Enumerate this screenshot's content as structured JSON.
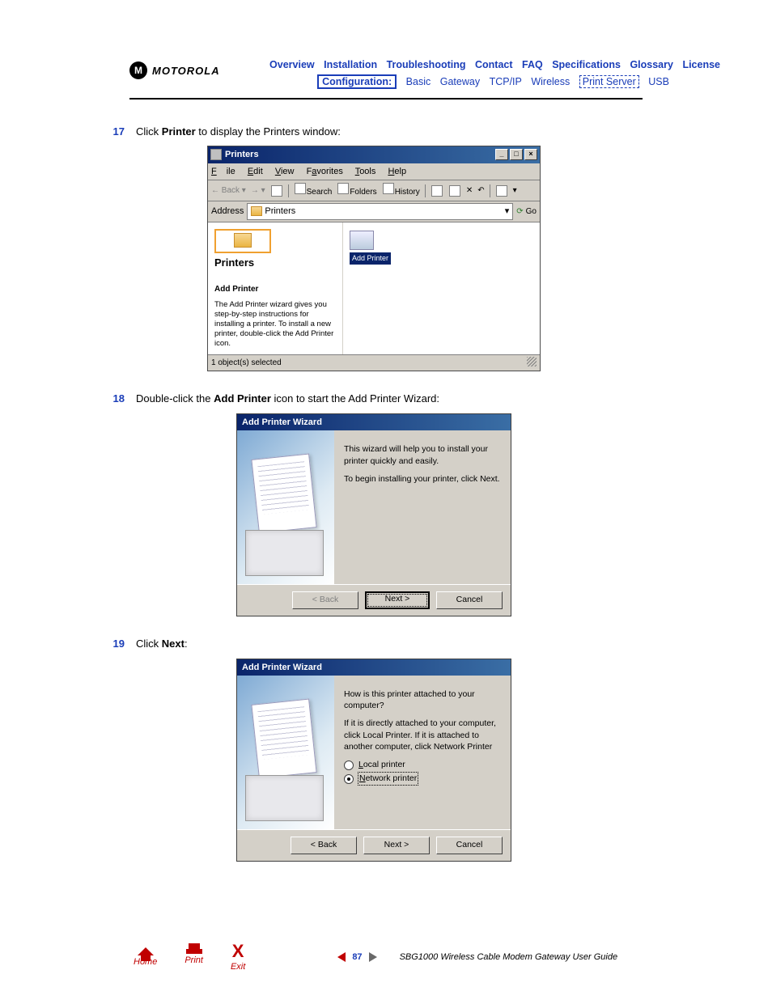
{
  "logo_text": "MOTOROLA",
  "nav_row1": [
    "Overview",
    "Installation",
    "Troubleshooting",
    "Contact",
    "FAQ",
    "Specifications",
    "Glossary",
    "License"
  ],
  "nav_sub_label": "Configuration:",
  "nav_sub": [
    "Basic",
    "Gateway",
    "TCP/IP",
    "Wireless"
  ],
  "nav_sub_ps": "Print Server",
  "nav_sub_last": "USB",
  "step17_num": "17",
  "step17_a": "Click ",
  "step17_b": "Printer",
  "step17_c": " to display the Printers window:",
  "step18_num": "18",
  "step18_a": "Double-click the ",
  "step18_b": "Add Printer",
  "step18_c": " icon to start the Add Printer Wizard:",
  "step19_num": "19",
  "step19_a": "Click ",
  "step19_b": "Next",
  "step19_c": ":",
  "win": {
    "title": "Printers",
    "menu_file": "File",
    "menu_edit": "Edit",
    "menu_view": "View",
    "menu_fav": "Favorites",
    "menu_tools": "Tools",
    "menu_help": "Help",
    "tb_back": "Back",
    "tb_search": "Search",
    "tb_folders": "Folders",
    "tb_history": "History",
    "addr_label": "Address",
    "addr_value": "Printers",
    "go": "Go",
    "left_title": "Printers",
    "left_sub": "Add Printer",
    "left_desc": "The Add Printer wizard gives you step-by-step instructions for installing a printer. To install a new printer, double-click the Add Printer icon.",
    "icon_label": "Add Printer",
    "status": "1 object(s) selected"
  },
  "wiz1": {
    "title": "Add Printer Wizard",
    "line1": "This wizard will help you to install your printer quickly and easily.",
    "line2": "To begin installing your printer, click Next.",
    "back": "< Back",
    "next": "Next >",
    "cancel": "Cancel"
  },
  "wiz2": {
    "title": "Add Printer Wizard",
    "q": "How is this printer attached to your computer?",
    "desc": "If it is directly attached to your computer, click Local Printer. If it is attached to another computer, click Network Printer",
    "opt_local": "Local printer",
    "opt_net": "Network printer",
    "back": "< Back",
    "next": "Next >",
    "cancel": "Cancel"
  },
  "footer": {
    "home": "Home",
    "print": "Print",
    "exit": "Exit",
    "page": "87",
    "guide": "SBG1000 Wireless Cable Modem Gateway User Guide"
  }
}
